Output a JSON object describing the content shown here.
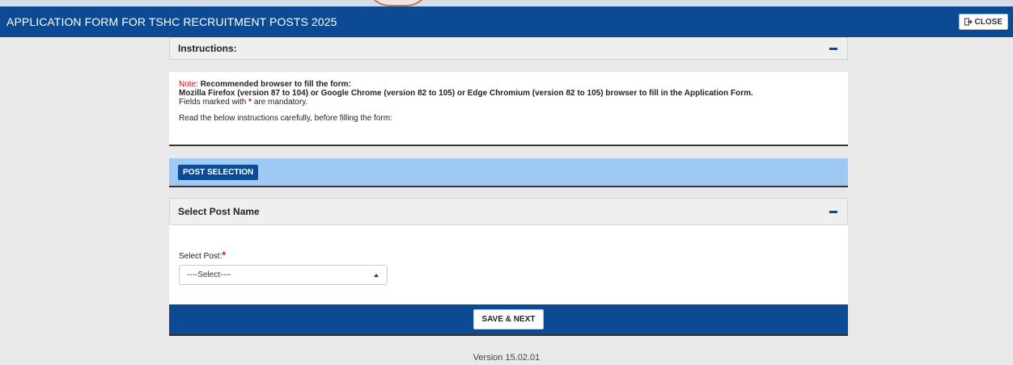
{
  "header": {
    "title": "APPLICATION FORM FOR TSHC RECRUITMENT POSTS 2025",
    "close_label": "CLOSE"
  },
  "instructions": {
    "heading": "Instructions:",
    "note_prefix": "Note:",
    "note_text": "Recommended browser to fill the form:",
    "browsers_line": "Mozilla Firefox (version 87 to 104) or Google Chrome (version 82 to 105) or Edge Chromium (version 82 to 105) browser to fill in the Application Form.",
    "mandatory_pre": "Fields marked with",
    "mandatory_star": "*",
    "mandatory_post": "are mandatory.",
    "read_line": "Read the below instructions carefully, before filling the form:"
  },
  "post_selection": {
    "tab_label": "POST SELECTION"
  },
  "select_post_panel": {
    "heading": "Select Post Name",
    "field_label": "Select Post:",
    "required_star": "*",
    "selected_value": "----Select----"
  },
  "actions": {
    "save_next_label": "SAVE & NEXT"
  },
  "footer": {
    "version": "Version 15.02.01"
  },
  "colors": {
    "primary": "#0c4b93",
    "band": "#9ec9f3",
    "required": "#e00000"
  }
}
